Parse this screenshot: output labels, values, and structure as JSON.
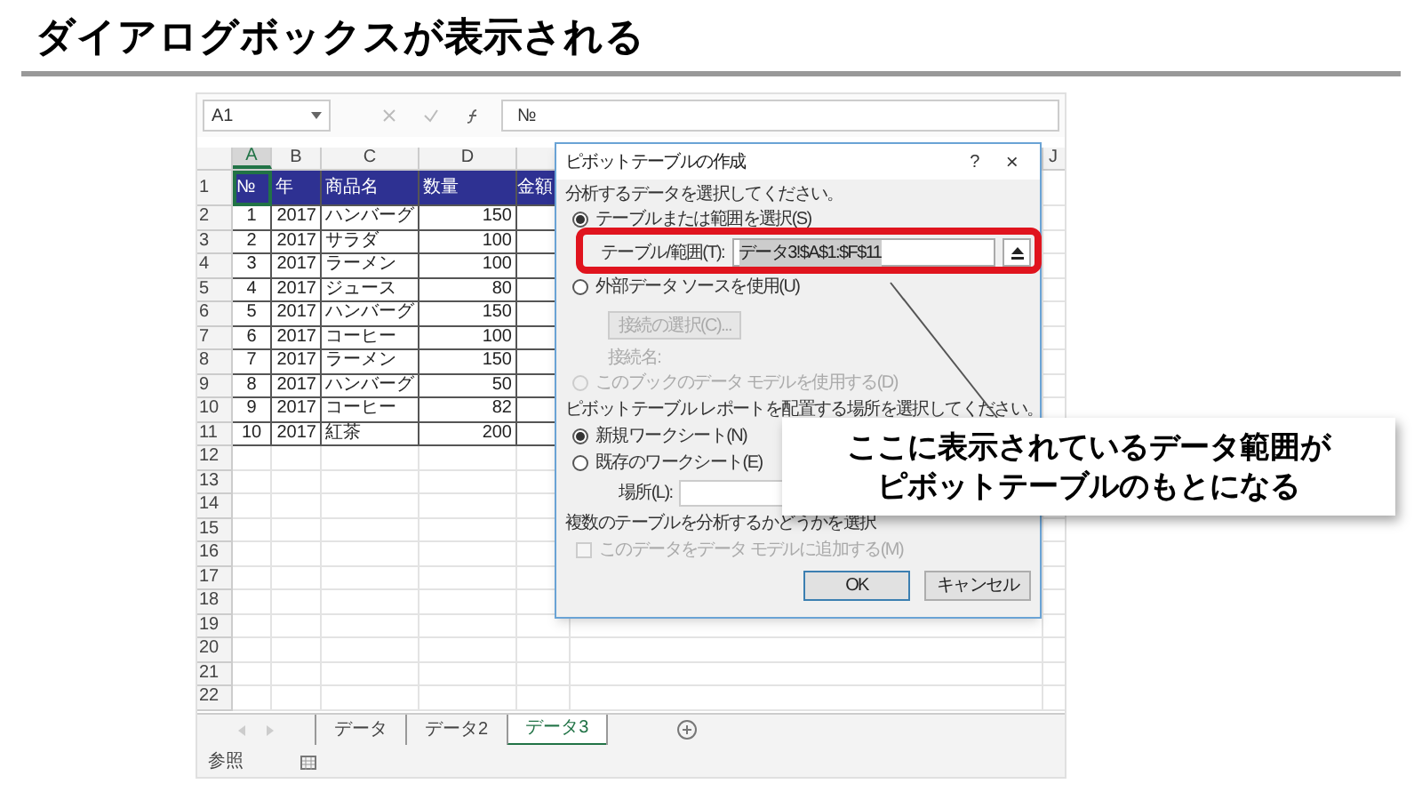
{
  "heading": "ダイアログボックスが表示される",
  "excel": {
    "name_box": "A1",
    "formula": "№",
    "columns": [
      {
        "label": "A",
        "selected": true
      },
      {
        "label": "B",
        "selected": false
      },
      {
        "label": "C",
        "selected": false
      },
      {
        "label": "D",
        "selected": false
      },
      {
        "label": "J",
        "selected": false
      }
    ],
    "header_row": [
      "№",
      "年",
      "商品名",
      "数量",
      "金額"
    ],
    "rows": [
      [
        "1",
        "2017",
        "ハンバーグ",
        "150"
      ],
      [
        "2",
        "2017",
        "サラダ",
        "100"
      ],
      [
        "3",
        "2017",
        "ラーメン",
        "100"
      ],
      [
        "4",
        "2017",
        "ジュース",
        "80"
      ],
      [
        "5",
        "2017",
        "ハンバーグ",
        "150"
      ],
      [
        "6",
        "2017",
        "コーヒー",
        "100"
      ],
      [
        "7",
        "2017",
        "ラーメン",
        "150"
      ],
      [
        "8",
        "2017",
        "ハンバーグ",
        "50"
      ],
      [
        "9",
        "2017",
        "コーヒー",
        "82"
      ],
      [
        "10",
        "2017",
        "紅茶",
        "200"
      ]
    ],
    "row_numbers": [
      "1",
      "2",
      "3",
      "4",
      "5",
      "6",
      "7",
      "8",
      "9",
      "10",
      "11",
      "12",
      "13",
      "14",
      "15",
      "16",
      "17",
      "18",
      "19",
      "20",
      "21",
      "22"
    ],
    "sheet_tabs": [
      {
        "label": "データ",
        "selected": false
      },
      {
        "label": "データ2",
        "selected": false
      },
      {
        "label": "データ3",
        "selected": true
      }
    ],
    "status": "参照"
  },
  "dialog": {
    "title": "ピボットテーブルの作成",
    "help": "?",
    "close": "×",
    "section_1": "分析するデータを選択してください。",
    "source_options": [
      {
        "label": "テーブルまたは範囲を選択(S)",
        "selected": true,
        "disabled": false
      },
      {
        "label": "外部データ ソースを使用(U)",
        "selected": false,
        "disabled": false
      }
    ],
    "range_label": "テーブル/範囲(T):",
    "range_value": "データ3!$A$1:$F$11",
    "connection_button": "接続の選択(C)...",
    "connection_name": "接続名:",
    "model_option": {
      "label": "このブックのデータ モデルを使用する(D)",
      "selected": false,
      "disabled": true
    },
    "section_2": "ピボットテーブル レポートを配置する場所を選択してください。",
    "location_options": [
      {
        "label": "新規ワークシート(N)",
        "selected": true
      },
      {
        "label": "既存のワークシート(E)",
        "selected": false
      }
    ],
    "location_label": "場所(L):",
    "section_3": "複数のテーブルを分析するかどうかを選択",
    "add_model": {
      "label": "このデータをデータ モデルに追加する(M)",
      "checked": false,
      "disabled": true
    },
    "buttons": [
      "OK",
      "キャンセル"
    ]
  },
  "callout": [
    "ここに表示されているデータ範囲が",
    "ピボットテーブルのもとになる"
  ]
}
